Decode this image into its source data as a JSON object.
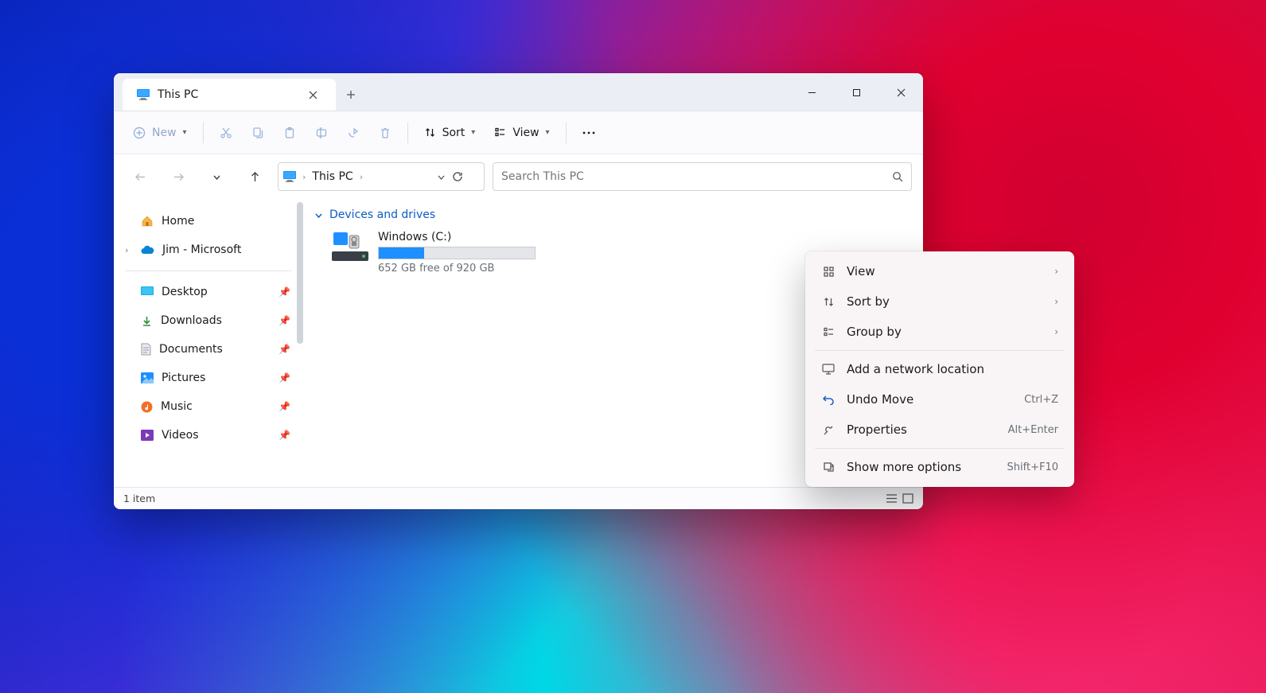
{
  "window": {
    "tab_title": "This PC",
    "controls": {
      "min": "minimize",
      "max": "maximize",
      "close": "close"
    }
  },
  "toolbar": {
    "new_label": "New",
    "sort_label": "Sort",
    "view_label": "View"
  },
  "nav": {
    "location": "This PC"
  },
  "search": {
    "placeholder": "Search This PC"
  },
  "sidebar": {
    "home": "Home",
    "cloud": "Jim - Microsoft",
    "quick": [
      {
        "label": "Desktop",
        "icon": "desktop"
      },
      {
        "label": "Downloads",
        "icon": "downloads"
      },
      {
        "label": "Documents",
        "icon": "documents"
      },
      {
        "label": "Pictures",
        "icon": "pictures"
      },
      {
        "label": "Music",
        "icon": "music"
      },
      {
        "label": "Videos",
        "icon": "videos"
      }
    ]
  },
  "content": {
    "group": "Devices and drives",
    "drive": {
      "label": "Windows  (C:)",
      "free_text": "652 GB free of 920 GB",
      "used_pct": 29
    }
  },
  "status": {
    "text": "1 item"
  },
  "context_menu": {
    "items_top": [
      {
        "label": "View",
        "icon": "grid",
        "arrow": true
      },
      {
        "label": "Sort by",
        "icon": "sort",
        "arrow": true
      },
      {
        "label": "Group by",
        "icon": "group",
        "arrow": true
      }
    ],
    "items_mid": [
      {
        "label": "Add a network location",
        "icon": "monitor"
      },
      {
        "label": "Undo Move",
        "icon": "undo",
        "shortcut": "Ctrl+Z"
      },
      {
        "label": "Properties",
        "icon": "wrench",
        "shortcut": "Alt+Enter"
      }
    ],
    "items_bot": [
      {
        "label": "Show more options",
        "icon": "more",
        "shortcut": "Shift+F10"
      }
    ]
  }
}
